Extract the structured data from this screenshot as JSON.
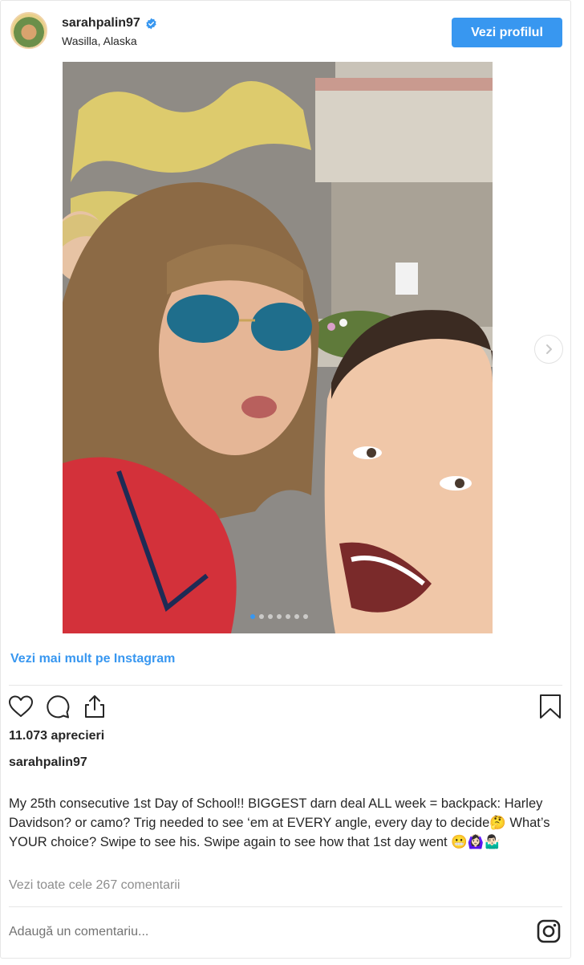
{
  "header": {
    "username": "sarahpalin97",
    "location": "Wasilla, Alaska",
    "profile_button": "Vezi profilul"
  },
  "media": {
    "slide_count": 7,
    "active_slide": 1
  },
  "more_link": "Vezi mai mult pe Instagram",
  "likes": "11.073 aprecieri",
  "caption": {
    "username": "sarahpalin97",
    "text": "My 25th consecutive 1st Day of School!! BIGGEST darn deal ALL week = backpack: Harley Davidson? or camo? Trig needed to see ‘em at EVERY angle, every day to decide🤔 What’s YOUR choice? Swipe to see his. Swipe again to see how that 1st day went 😬🙆🏻‍♀️🤷🏻‍♂️"
  },
  "comments_link": "Vezi toate cele 267 comentarii",
  "comment_input": {
    "placeholder": "Adaugă un comentariu..."
  },
  "colors": {
    "accent": "#3897f0",
    "text": "#262626",
    "muted": "#8e8e8e",
    "border": "#e6e6e6"
  },
  "icons": [
    "verified-badge-icon",
    "heart-icon",
    "comment-icon",
    "share-icon",
    "bookmark-icon",
    "chevron-right-icon",
    "instagram-icon"
  ]
}
